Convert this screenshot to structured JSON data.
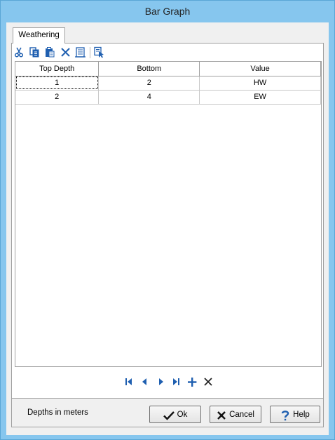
{
  "window": {
    "title": "Bar Graph"
  },
  "tabs": [
    {
      "label": "Weathering"
    }
  ],
  "toolbar": {
    "buttons": [
      {
        "name": "cut-button",
        "icon": "scissors-icon"
      },
      {
        "name": "copy-button",
        "icon": "copy-icon"
      },
      {
        "name": "paste-button",
        "icon": "paste-icon"
      },
      {
        "name": "delete-button",
        "icon": "delete-x-icon"
      },
      {
        "name": "clear-button",
        "icon": "clear-table-icon"
      },
      {
        "name": "select-button",
        "icon": "select-cursor-icon"
      }
    ]
  },
  "table": {
    "columns": [
      "Top Depth",
      "Bottom",
      "Value"
    ],
    "rows": [
      [
        "1",
        "2",
        "HW"
      ],
      [
        "2",
        "4",
        "EW"
      ]
    ]
  },
  "navigator": {
    "buttons": [
      "first-record",
      "prior-record",
      "next-record",
      "last-record",
      "insert-record",
      "delete-record"
    ]
  },
  "footer": {
    "status": "Depths in meters",
    "ok_label": "Ok",
    "cancel_label": "Cancel",
    "help_label": "Help"
  },
  "colors": {
    "accent": "#1f5fb0",
    "frame": "#86c6ee"
  }
}
